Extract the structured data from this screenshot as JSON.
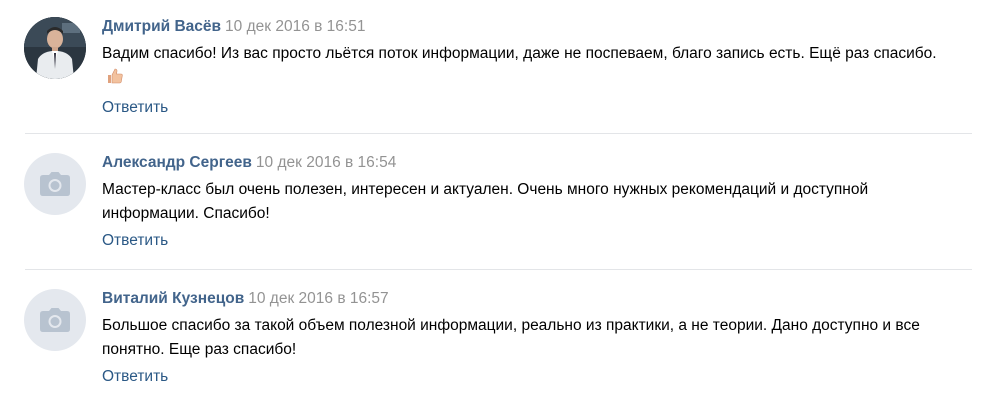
{
  "comments": [
    {
      "author": "Дмитрий Васёв",
      "date": "10 дек 2016 в 16:51",
      "text": "Вадим спасибо! Из вас просто льётся поток информации, даже не поспеваем, благо запись есть. Ещё раз спасибо.",
      "emoji": "thumbs-up-icon",
      "reply_label": "Ответить",
      "avatar": "user-photo"
    },
    {
      "author": "Александр Сергеев",
      "date": "10 дек 2016 в 16:54",
      "text": "Мастер-класс был очень полезен, интересен и актуален. Очень много нужных рекомендаций и доступной информации. Спасибо!",
      "reply_label": "Ответить",
      "avatar": "camera-icon"
    },
    {
      "author": "Виталий Кузнецов",
      "date": "10 дек 2016 в 16:57",
      "text": "Большое спасибо за такой объем полезной информации, реально из практики, а не теории. Дано доступно и все понятно. Еще раз спасибо!",
      "reply_label": "Ответить",
      "avatar": "camera-icon"
    }
  ],
  "colors": {
    "author": "#42648b",
    "date": "#939393",
    "reply": "#2a5885",
    "divider": "#e3e5e8",
    "avatar_placeholder": "#e4e8ee"
  }
}
